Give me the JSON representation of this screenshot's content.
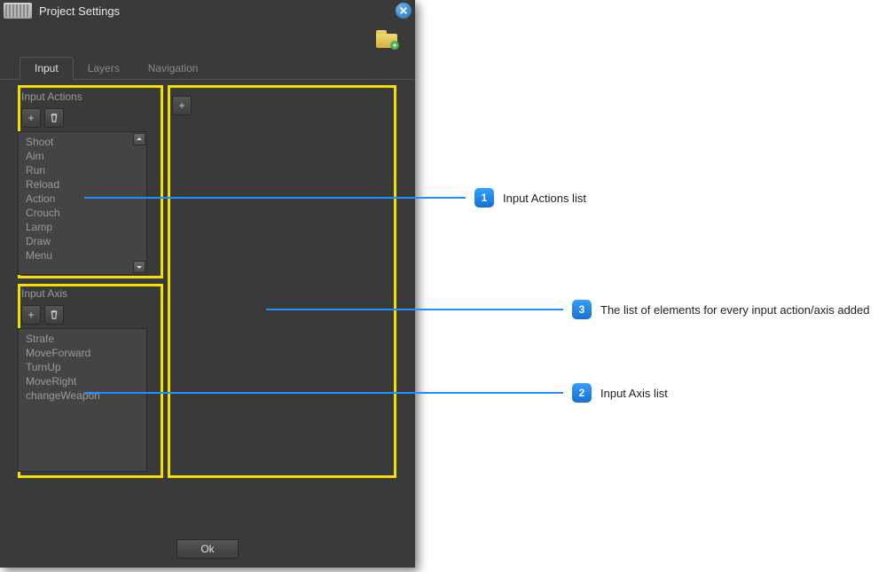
{
  "window": {
    "title": "Project Settings"
  },
  "tabs": [
    "Input",
    "Layers",
    "Navigation"
  ],
  "active_tab": 0,
  "sections": {
    "actions": {
      "label": "Input Actions",
      "items": [
        "Shoot",
        "Aim",
        "Run",
        "Reload",
        "Action",
        "Crouch",
        "Lamp",
        "Draw",
        "Menu"
      ]
    },
    "axis": {
      "label": "Input Axis",
      "items": [
        "Strafe",
        "MoveForward",
        "TurnUp",
        "MoveRight",
        "changeWeapon"
      ]
    }
  },
  "buttons": {
    "add": "+",
    "ok": "Ok"
  },
  "callouts": [
    {
      "num": "1",
      "text": "Input Actions list"
    },
    {
      "num": "2",
      "text": "Input Axis list"
    },
    {
      "num": "3",
      "text": "The list of elements for every input action/axis added"
    }
  ]
}
